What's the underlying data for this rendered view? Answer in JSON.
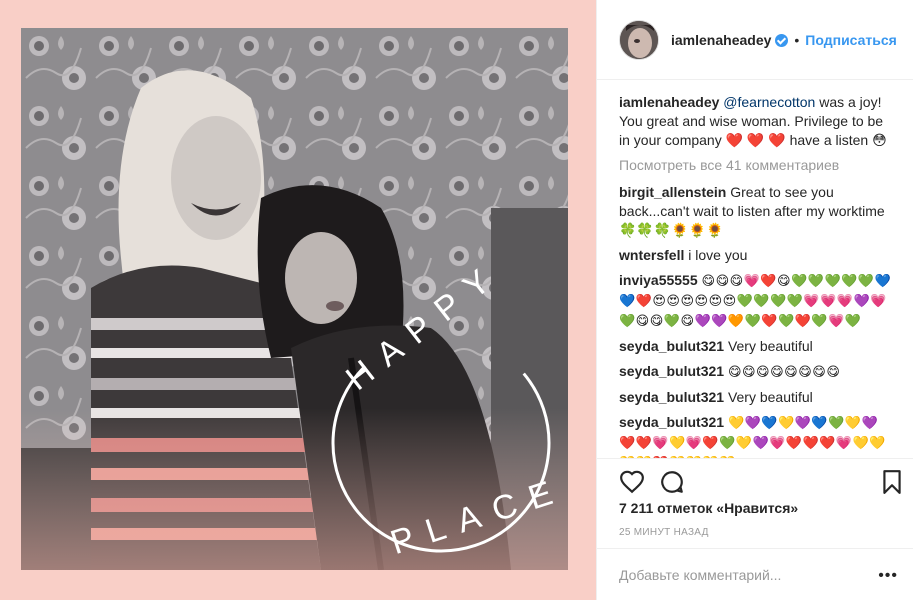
{
  "post": {
    "overlay_text_top": "HAPPY",
    "overlay_text_bottom": "PLACE"
  },
  "header": {
    "username": "iamlenaheadey",
    "separator": "•",
    "follow_label": "Подписаться"
  },
  "caption": {
    "username": "iamlenaheadey",
    "mention": "@fearnecotton",
    "text": " was a joy! You great and wise woman. Privilege to be in your company ❤️ ❤️ ❤️  have a listen 😳"
  },
  "view_all_comments": "Посмотреть все 41 комментариев",
  "comments": [
    {
      "user": "birgit_allenstein",
      "text": "Great to see you back...can't wait to listen after my worktime 🍀🍀🍀🌻🌻🌻"
    },
    {
      "user": "wntersfell",
      "text": "i love you"
    },
    {
      "user": "inviya55555",
      "text": "😋😋😋💗❤️😋💚💚💚💚💚💙💙❤️😍😍😍😍😍😍💚💚💚💚💗💗💗💜💗💚😋😋💚😋💜💜🧡💚❤️💚❤️💚💗💚"
    },
    {
      "user": "seyda_bulut321",
      "text": "Very beautiful"
    },
    {
      "user": "seyda_bulut321",
      "text": "😋😋😋😋😋😋😋😋"
    },
    {
      "user": "seyda_bulut321",
      "text": "Very beautiful"
    },
    {
      "user": "seyda_bulut321",
      "text": "💛💜💙💛💜💙💚💛💜❤️❤️💗💛💗❤️💚💛💜💗❤️❤️❤️💗💛💛💛💛❤️💛💛💛💛"
    }
  ],
  "likes": "7 211 отметок «Нравится»",
  "timestamp": "25 МИНУТ НАЗАД",
  "add_comment_placeholder": "Добавьте комментарий...",
  "more_options": "•••",
  "colors": {
    "frame_pink": "#f9cfc7",
    "link_blue": "#3897f0",
    "mention_blue": "#003569",
    "muted_grey": "#999999"
  }
}
